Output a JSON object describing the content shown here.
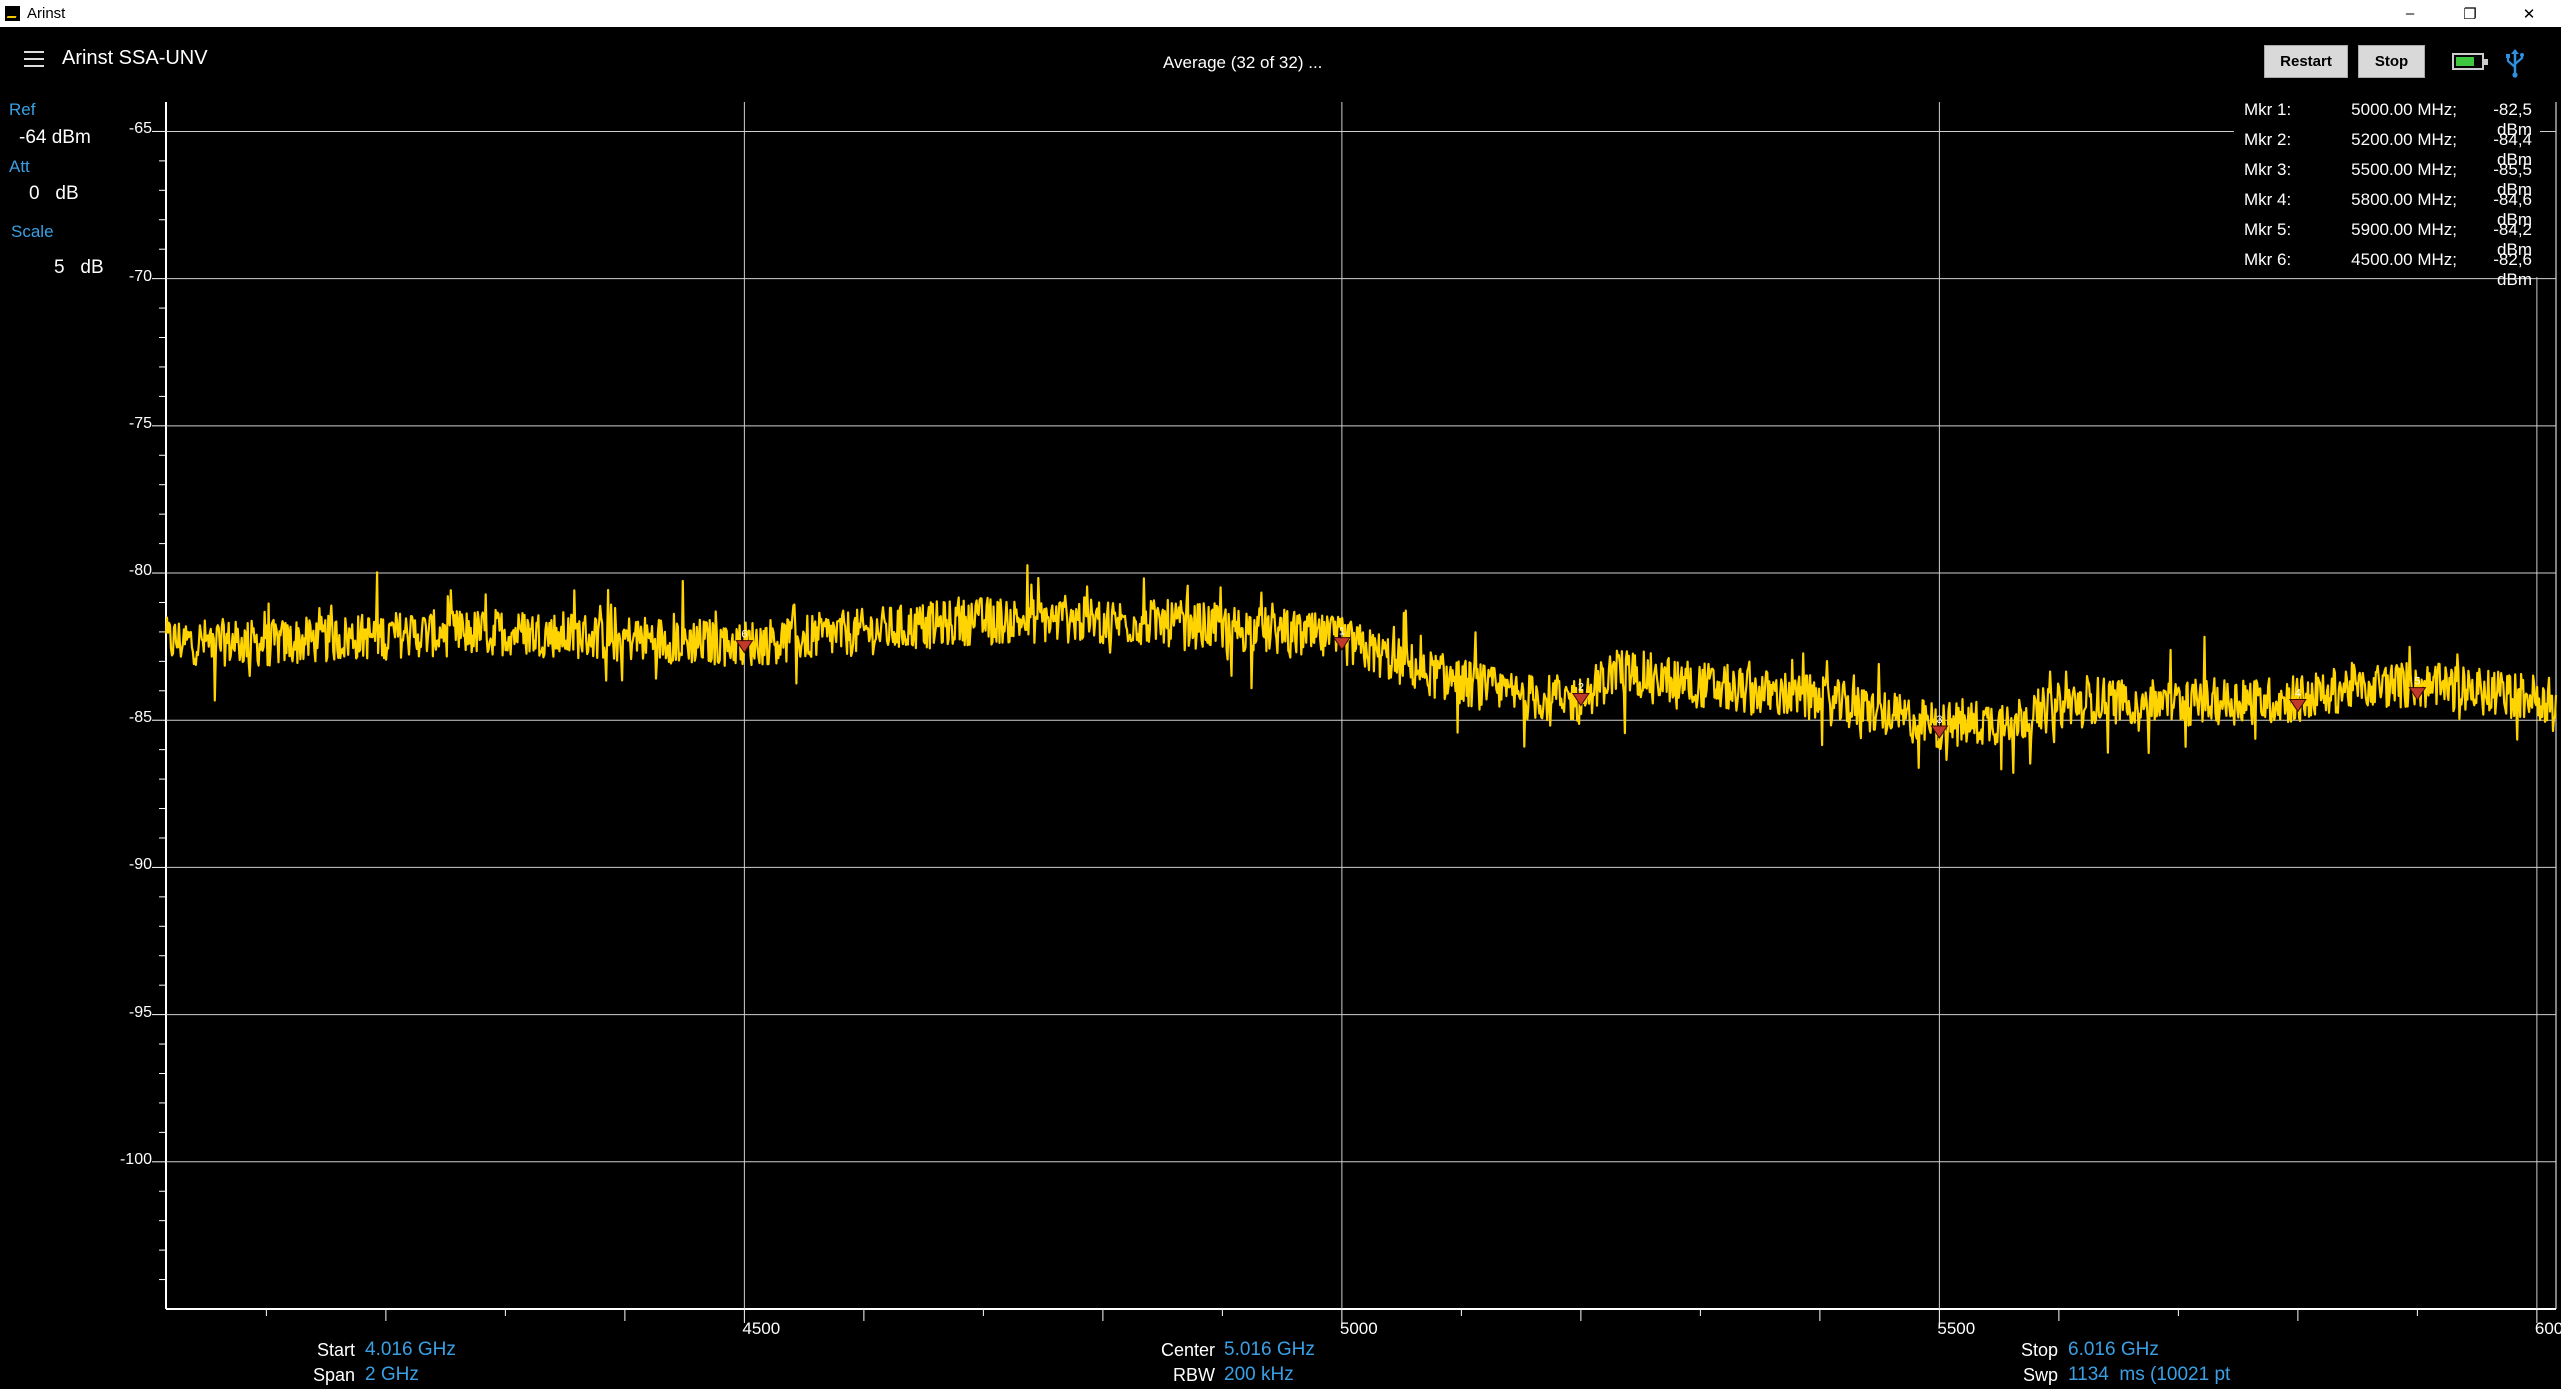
{
  "window": {
    "title": "Arinst",
    "minimize": "–",
    "maximize": "❐",
    "close": "✕"
  },
  "header": {
    "app_name": "Arinst SSA-UNV",
    "status": "Average (32 of 32) ...",
    "restart_label": "Restart",
    "stop_label": "Stop",
    "menu_icon": "hamburger-menu-icon",
    "battery_icon": "battery-icon",
    "usb_icon": "usb-icon"
  },
  "settings": {
    "ref_label": "Ref",
    "ref_value": "-64 dBm",
    "att_label": "Att",
    "att_value": "0   dB",
    "scale_label": "Scale",
    "scale_value": "5   dB"
  },
  "markers": [
    {
      "name": "Mkr 1:",
      "freq": "5000.00 MHz;",
      "level": "-82,5 dBm"
    },
    {
      "name": "Mkr 2:",
      "freq": "5200.00 MHz;",
      "level": "-84,4 dBm"
    },
    {
      "name": "Mkr 3:",
      "freq": "5500.00 MHz;",
      "level": "-85,5 dBm"
    },
    {
      "name": "Mkr 4:",
      "freq": "5800.00 MHz;",
      "level": "-84,6 dBm"
    },
    {
      "name": "Mkr 5:",
      "freq": "5900.00 MHz;",
      "level": "-84,2 dBm"
    },
    {
      "name": "Mkr 6:",
      "freq": "4500.00 MHz;",
      "level": "-82,6 dBm"
    }
  ],
  "footer": {
    "start_label": "Start",
    "start_value": "4.016 GHz",
    "span_label": "Span",
    "span_value": "2 GHz",
    "center_label": "Center",
    "center_value": "5.016 GHz",
    "rbw_label": "RBW",
    "rbw_value": "200 kHz",
    "stop_label": "Stop",
    "stop_value": "6.016 GHz",
    "swp_label": "Swp",
    "swp_value": "1134  ms (10021 pt"
  },
  "colors": {
    "trace": "#ffd400",
    "accent": "#3aa0e6",
    "grid": "#ffffff",
    "marker": "#c0392b"
  },
  "chart_data": {
    "type": "line",
    "xlabel": "",
    "ylabel": "",
    "xlim": [
      4016,
      6016
    ],
    "ylim": [
      -105,
      -64
    ],
    "xticks": [
      4500,
      5000,
      5500,
      6000
    ],
    "xtick_labels": [
      "4500",
      "5000",
      "5500",
      "600"
    ],
    "yticks": [
      -65,
      -70,
      -75,
      -80,
      -85,
      -90,
      -95,
      -100
    ],
    "grid": true,
    "series": [
      {
        "x": [
          4016,
          4100,
          4200,
          4300,
          4400,
          4500,
          4600,
          4650,
          4700,
          4780,
          4850,
          4950,
          5000,
          5080,
          5150,
          5200,
          5230,
          5300,
          5400,
          5500,
          5560,
          5620,
          5700,
          5800,
          5850,
          5900,
          6016
        ],
        "values": [
          -82.3,
          -82.4,
          -82.1,
          -82.0,
          -82.2,
          -82.4,
          -82.0,
          -81.8,
          -81.6,
          -81.6,
          -81.7,
          -82.0,
          -82.3,
          -83.5,
          -84.2,
          -84.3,
          -83.3,
          -83.8,
          -84.3,
          -85.2,
          -85.0,
          -84.3,
          -84.4,
          -84.3,
          -83.8,
          -83.8,
          -84.3
        ]
      }
    ],
    "markers": [
      {
        "id": 1,
        "x": 5000,
        "y": -82.5
      },
      {
        "id": 2,
        "x": 5200,
        "y": -84.4
      },
      {
        "id": 3,
        "x": 5500,
        "y": -85.5
      },
      {
        "id": 4,
        "x": 5800,
        "y": -84.6
      },
      {
        "id": 5,
        "x": 5900,
        "y": -84.2
      },
      {
        "id": 6,
        "x": 4500,
        "y": -82.6
      }
    ]
  }
}
